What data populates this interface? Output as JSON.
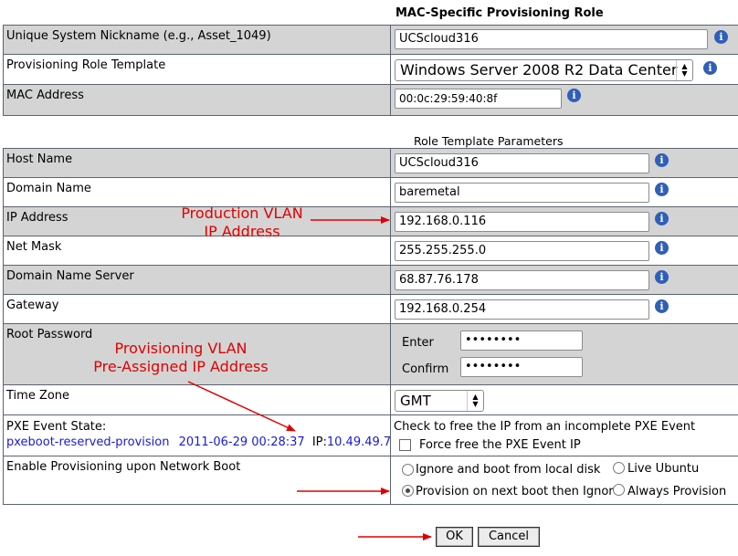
{
  "mac_section": {
    "title": "MAC-Specific Provisioning Role",
    "nickname_label": "Unique System Nickname (e.g., Asset_1049)",
    "nickname_value": "UCScloud316",
    "role_label": "Provisioning Role Template",
    "role_value": "Windows Server 2008 R2 Data Center",
    "mac_label": "MAC Address",
    "mac_value": "00:0c:29:59:40:8f"
  },
  "params_section": {
    "title": "Role Template Parameters",
    "host_label": "Host Name",
    "host_value": "UCScloud316",
    "domain_label": "Domain Name",
    "domain_value": "baremetal",
    "ip_label": "IP Address",
    "ip_value": "192.168.0.116",
    "mask_label": "Net Mask",
    "mask_value": "255.255.255.0",
    "dns_label": "Domain Name Server",
    "dns_value": "68.87.76.178",
    "gw_label": "Gateway",
    "gw_value": "192.168.0.254",
    "rootpw_label": "Root Password",
    "enter_label": "Enter",
    "enter_value": "••••••••",
    "confirm_label": "Confirm",
    "confirm_value": "••••••••",
    "tz_label": "Time Zone",
    "tz_value": "GMT",
    "pxe_label": "PXE Event State:",
    "pxe_event": "pxeboot-reserved-provision",
    "pxe_time": "2011-06-29 00:28:37",
    "pxe_ip_prefix": "IP:",
    "pxe_ip": "10.49.49.7",
    "free_text": "Check to free the IP from an incomplete PXE Event",
    "force_free_label": "Force free the PXE Event IP",
    "enable_label": "Enable Provisioning upon Network Boot",
    "radio_ignore": "Ignore and boot from local disk",
    "radio_live": "Live Ubuntu",
    "radio_provision": "Provision on next boot then Ignore",
    "radio_always": "Always Provision"
  },
  "annotations": {
    "production_line1": "Production VLAN",
    "production_line2": "IP Address",
    "provisioning_line1": "Provisioning VLAN",
    "provisioning_line2": "Pre-Assigned IP Address"
  },
  "buttons": {
    "ok": "OK",
    "cancel": "Cancel"
  },
  "info_glyph": "i",
  "colors": {
    "row_gray": "#d4d4d4",
    "annotation_red": "#e00000",
    "link_blue": "#1a1ad6",
    "info_blue": "#2f5fb8"
  }
}
